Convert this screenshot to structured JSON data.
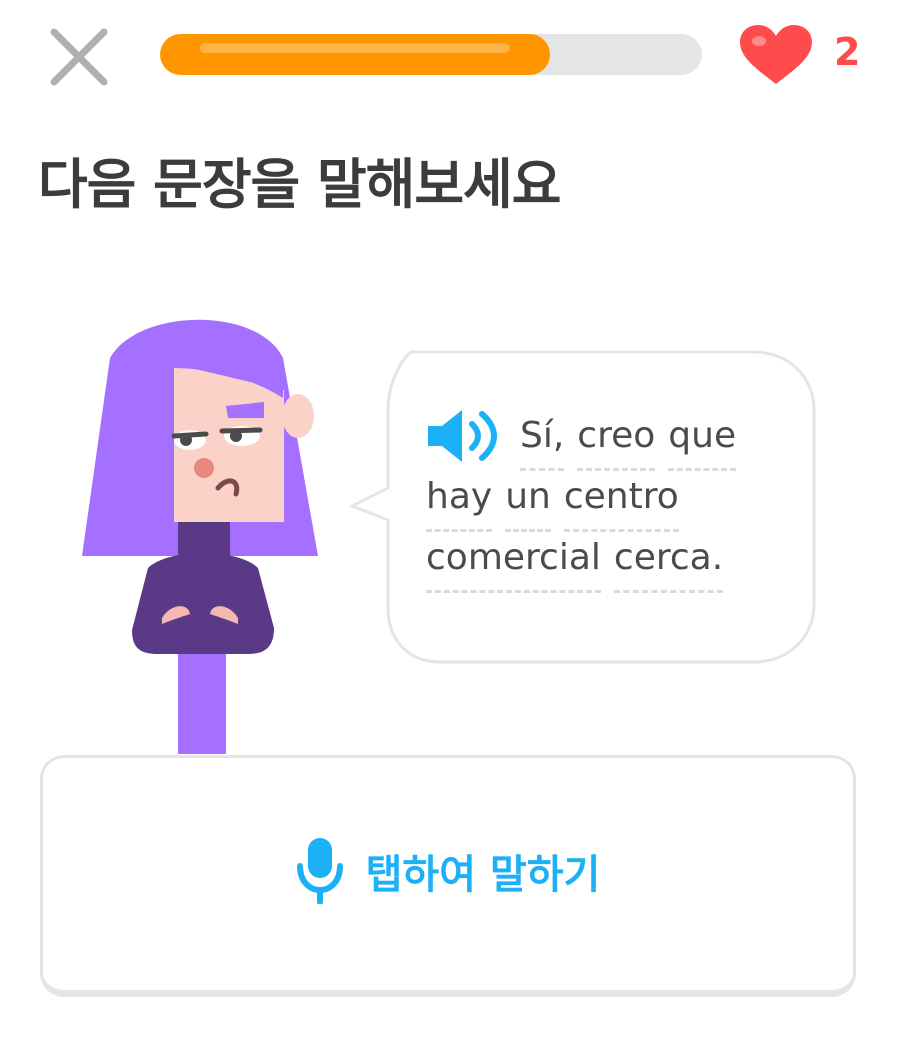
{
  "colors": {
    "progress_fill": "#ff9600",
    "progress_track": "#e5e5e5",
    "heart": "#ff4b4b",
    "accent_blue": "#1cb0f6",
    "title_text": "#3c3c3c",
    "character_hair": "#a570ff",
    "character_sweater": "#5a3a87"
  },
  "header": {
    "close_icon": "close-x-icon",
    "progress": 0.72,
    "hearts_icon": "heart-icon",
    "hearts_count": "2"
  },
  "prompt": {
    "title": "다음 문장을 말해보세요"
  },
  "bubble": {
    "speaker_icon": "speaker-icon",
    "lines": [
      [
        "Sí,",
        "creo",
        "que"
      ],
      [
        "hay",
        "un",
        "centro"
      ],
      [
        "comercial",
        "cerca."
      ]
    ]
  },
  "speak": {
    "icon": "microphone-icon",
    "label": "탭하여 말하기"
  }
}
